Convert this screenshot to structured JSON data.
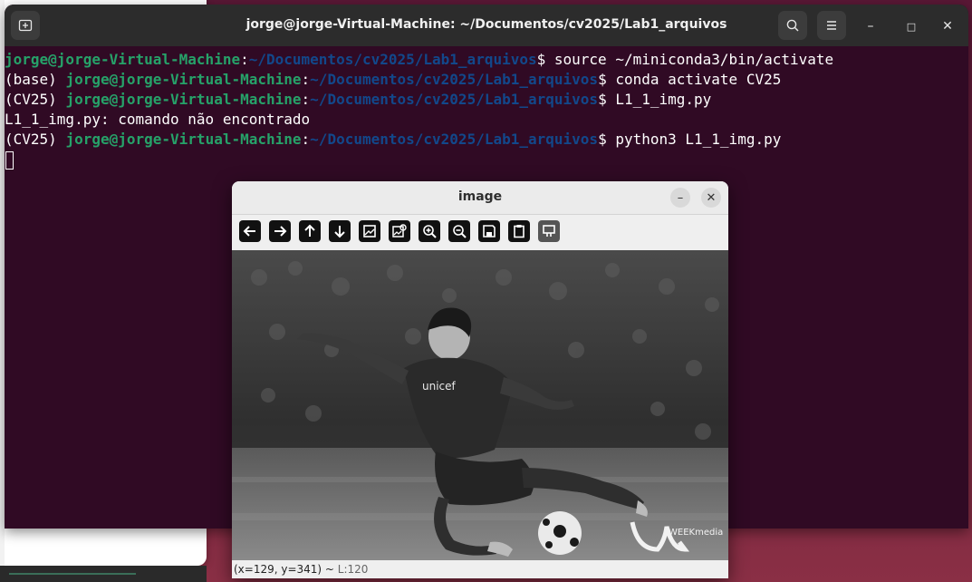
{
  "terminal": {
    "title": "jorge@jorge-Virtual-Machine: ~/Documentos/cv2025/Lab1_arquivos",
    "lines": [
      {
        "prefix": "",
        "user": "jorge@jorge-Virtual-Machine",
        "colon": ":",
        "path": "~/Documentos/cv2025/Lab1_arquivos",
        "cmd": "$ source ~/miniconda3/bin/activate"
      },
      {
        "prefix": "(base) ",
        "user": "jorge@jorge-Virtual-Machine",
        "colon": ":",
        "path": "~/Documentos/cv2025/Lab1_arquivos",
        "cmd": "$ conda activate CV25"
      },
      {
        "prefix": "(CV25) ",
        "user": "jorge@jorge-Virtual-Machine",
        "colon": ":",
        "path": "~/Documentos/cv2025/Lab1_arquivos",
        "cmd": "$ L1_1_img.py"
      },
      {
        "text": "L1_1_img.py: comando não encontrado"
      },
      {
        "prefix": "(CV25) ",
        "user": "jorge@jorge-Virtual-Machine",
        "colon": ":",
        "path": "~/Documentos/cv2025/Lab1_arquivos",
        "cmd": "$ python3 L1_1_img.py"
      }
    ],
    "icons": {
      "new_tab": "new-tab-icon",
      "search": "search-icon",
      "menu": "hamburger-menu-icon"
    },
    "controls": {
      "minimize": "–",
      "maximize": "□",
      "close": "✕"
    }
  },
  "image_window": {
    "title": "image",
    "minimize": "–",
    "close": "✕",
    "toolbar": [
      {
        "name": "pan-left-button",
        "icon": "arrow-left-icon"
      },
      {
        "name": "pan-right-button",
        "icon": "arrow-right-icon"
      },
      {
        "name": "pan-up-button",
        "icon": "arrow-up-icon"
      },
      {
        "name": "pan-down-button",
        "icon": "arrow-down-icon"
      },
      {
        "name": "zoom-fit-button",
        "icon": "image-icon"
      },
      {
        "name": "zoom-original-button",
        "icon": "image-zoom-icon"
      },
      {
        "name": "zoom-in-button",
        "icon": "zoom-in-icon"
      },
      {
        "name": "zoom-out-button",
        "icon": "zoom-out-icon"
      },
      {
        "name": "save-button",
        "icon": "save-icon"
      },
      {
        "name": "copy-button",
        "icon": "clipboard-icon"
      },
      {
        "name": "properties-button",
        "icon": "properties-icon"
      }
    ],
    "watermark": "WEEKmedia",
    "status": {
      "coords": "(x=129, y=341) ~",
      "value": " L:120"
    }
  },
  "colors": {
    "terminal_bg": "#300a24",
    "user": "#26a269",
    "path": "#12488b"
  }
}
